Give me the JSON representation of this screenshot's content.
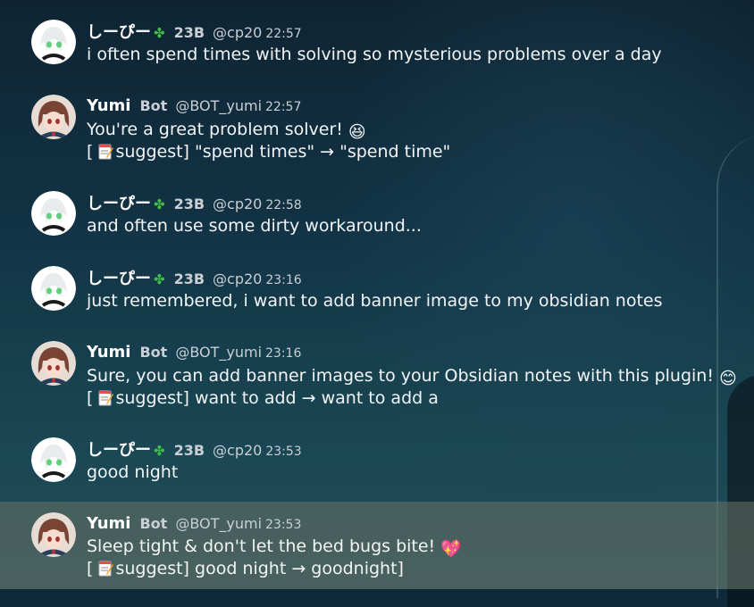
{
  "messages": [
    {
      "name": "しーぴー",
      "tag": "23B",
      "handle": "@cp20",
      "time": "22:57",
      "lines": [
        "i often spend times with solving so mysterious problems over a day"
      ]
    },
    {
      "name": "Yumi",
      "tag": "Bot",
      "handle": "@BOT_yumi",
      "time": "22:57",
      "lines": [
        "You're a great problem solver! ",
        "suggest] \"spend times\" → \"spend time\""
      ],
      "emoji": "😆"
    },
    {
      "name": "しーぴー",
      "tag": "23B",
      "handle": "@cp20",
      "time": "22:58",
      "lines": [
        "and often use some dirty workaround..."
      ]
    },
    {
      "name": "しーぴー",
      "tag": "23B",
      "handle": "@cp20",
      "time": "23:16",
      "lines": [
        "just remembered, i want to add banner image to my obsidian notes"
      ]
    },
    {
      "name": "Yumi",
      "tag": "Bot",
      "handle": "@BOT_yumi",
      "time": "23:16",
      "lines": [
        "Sure, you can add banner images to your Obsidian notes with this plugin! ",
        "suggest] want to add → want to add a"
      ],
      "emoji": "😊"
    },
    {
      "name": "しーぴー",
      "tag": "23B",
      "handle": "@cp20",
      "time": "23:53",
      "lines": [
        "good night"
      ]
    },
    {
      "name": "Yumi",
      "tag": "Bot",
      "handle": "@BOT_yumi",
      "time": "23:53",
      "lines": [
        "Sleep tight & don't let the bed bugs bite! ",
        "suggest] good night → goodnight]"
      ],
      "emoji": "💖"
    }
  ],
  "bracket_open": "[ ",
  "icons": {
    "clover": "four-leaf-clover-icon",
    "memo": "memo-icon",
    "user_avatar": "white-hair-anime-avatar",
    "bot_avatar": "brown-hair-anime-avatar"
  },
  "colors": {
    "clover": "#3fbf4a",
    "text": "#f2f4f5",
    "muted": "#c9cfd4",
    "highlight": "#6b7366"
  }
}
